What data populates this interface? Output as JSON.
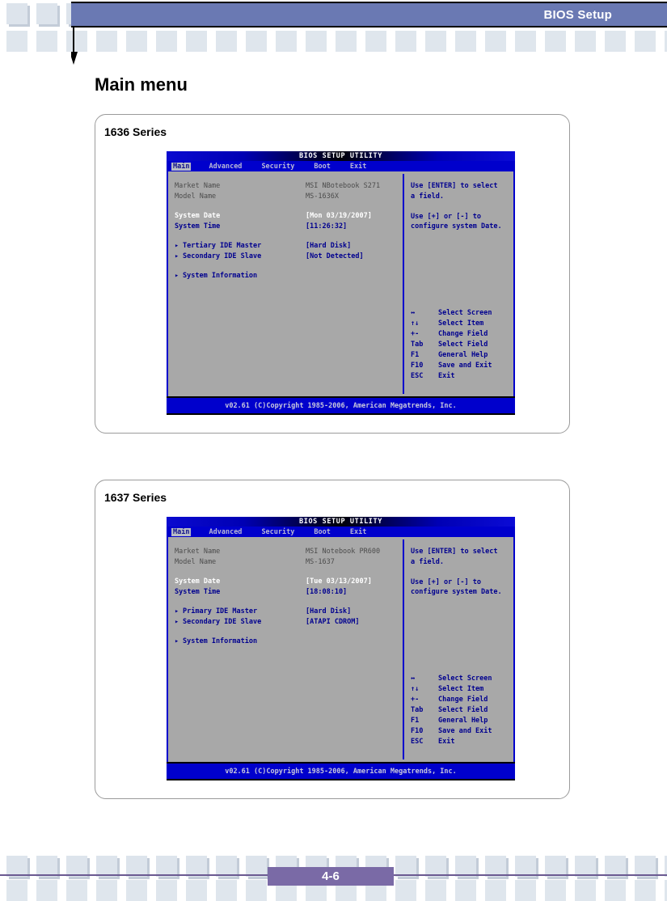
{
  "header": {
    "title": "BIOS Setup"
  },
  "page": {
    "title": "Main menu",
    "number": "4-6"
  },
  "cards": [
    {
      "label": "1636 Series",
      "bios": {
        "title": "BIOS SETUP UTILITY",
        "tabs": [
          "Main",
          "Advanced",
          "Security",
          "Boot",
          "Exit"
        ],
        "active_tab": "Main",
        "fields": [
          {
            "label": "Market Name",
            "value": "MSI NBotebook S271",
            "style": "gray"
          },
          {
            "label": "Model Name",
            "value": "MS-1636X",
            "style": "gray"
          },
          {
            "label": "System Date",
            "value": "[Mon 03/19/2007]",
            "style": "white"
          },
          {
            "label": "System Time",
            "value": "[11:26:32]",
            "style": "blue"
          },
          {
            "label": "Tertiary IDE Master",
            "value": "[Hard Disk]",
            "style": "blue",
            "bullet": true
          },
          {
            "label": "Secondary IDE Slave",
            "value": "[Not Detected]",
            "style": "blue",
            "bullet": true
          },
          {
            "label": "System Information",
            "value": "",
            "style": "blue",
            "bullet": true
          }
        ],
        "help": [
          "Use [ENTER] to select",
          "a field.",
          "",
          "Use [+] or [-] to",
          "configure system Date."
        ],
        "keys": [
          {
            "key": "↔",
            "action": "Select Screen"
          },
          {
            "key": "↑↓",
            "action": "Select Item"
          },
          {
            "key": "+-",
            "action": "Change Field"
          },
          {
            "key": "Tab",
            "action": "Select Field"
          },
          {
            "key": "F1",
            "action": "General Help"
          },
          {
            "key": "F10",
            "action": "Save and Exit"
          },
          {
            "key": "ESC",
            "action": "Exit"
          }
        ],
        "footer": "v02.61 (C)Copyright 1985-2006, American Megatrends, Inc."
      }
    },
    {
      "label": "1637 Series",
      "bios": {
        "title": "BIOS SETUP UTILITY",
        "tabs": [
          "Main",
          "Advanced",
          "Security",
          "Boot",
          "Exit"
        ],
        "active_tab": "Main",
        "fields": [
          {
            "label": "Market Name",
            "value": "MSI Notebook PR600",
            "style": "gray"
          },
          {
            "label": "Model Name",
            "value": "MS-1637",
            "style": "gray"
          },
          {
            "label": "System Date",
            "value": "[Tue 03/13/2007]",
            "style": "white"
          },
          {
            "label": "System Time",
            "value": "[18:08:10]",
            "style": "blue"
          },
          {
            "label": "Primary IDE Master",
            "value": "[Hard Disk]",
            "style": "blue",
            "bullet": true
          },
          {
            "label": "Secondary IDE Slave",
            "value": "[ATAPI CDROM]",
            "style": "blue",
            "bullet": true
          },
          {
            "label": "System Information",
            "value": "",
            "style": "blue",
            "bullet": true
          }
        ],
        "help": [
          "Use [ENTER] to select",
          "a field.",
          "",
          "Use [+] or [-] to",
          "configure system Date."
        ],
        "keys": [
          {
            "key": "↔",
            "action": "Select Screen"
          },
          {
            "key": "↑↓",
            "action": "Select Item"
          },
          {
            "key": "+-",
            "action": "Change Field"
          },
          {
            "key": "Tab",
            "action": "Select Field"
          },
          {
            "key": "F1",
            "action": "General Help"
          },
          {
            "key": "F10",
            "action": "Save and Exit"
          },
          {
            "key": "ESC",
            "action": "Exit"
          }
        ],
        "footer": "v02.61 (C)Copyright 1985-2006, American Megatrends, Inc."
      }
    }
  ],
  "colors": {
    "header_bar": "#6a79b3",
    "bios_blue": "#0000cc",
    "bios_body_gray": "#a8a8a8",
    "page_number_bar": "#7a6aa6",
    "key_square": "#dde4ec"
  }
}
